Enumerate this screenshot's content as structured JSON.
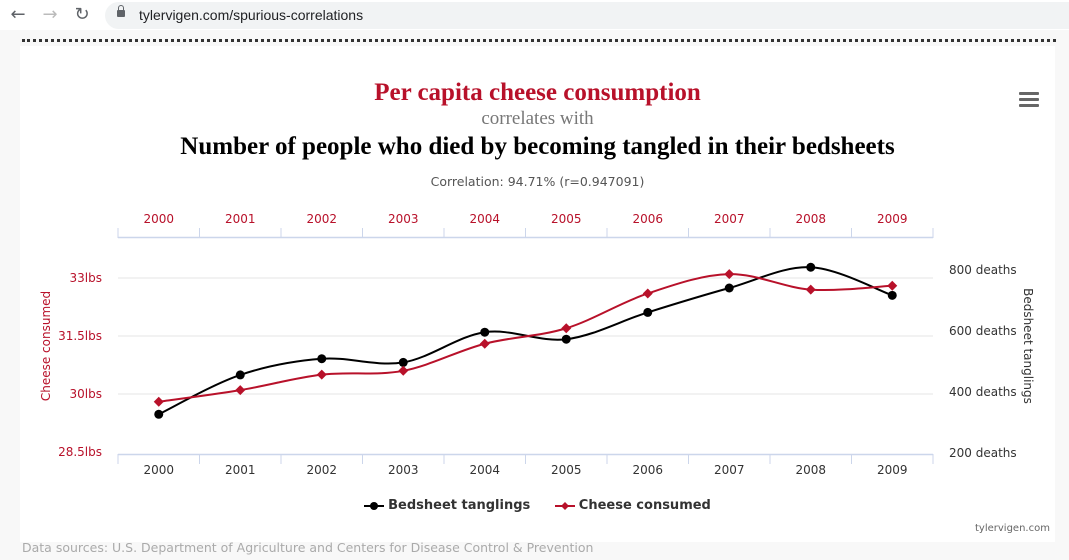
{
  "browser": {
    "url": "tylervigen.com/spurious-correlations",
    "back_icon": "←",
    "forward_icon": "→",
    "reload_icon": "↻"
  },
  "header": {
    "title_series1": "Per capita cheese consumption",
    "connector": "correlates with",
    "title_series2": "Number of people who died by becoming tangled in their bedsheets",
    "correlation": "Correlation: 94.71% (r=0.947091)"
  },
  "legend": {
    "items": [
      "Bedsheet tanglings",
      "Cheese consumed"
    ]
  },
  "footer": {
    "credit": "tylervigen.com",
    "sources": "Data sources: U.S. Department of Agriculture and Centers for Disease Control & Prevention"
  },
  "colors": {
    "cheese": "#b8112a",
    "bedsheet": "#000000",
    "grid": "#e6e6e6",
    "axis": "#ccd6eb"
  },
  "chart_data": {
    "type": "line",
    "title": "Per capita cheese consumption correlates with Number of people who died by becoming tangled in their bedsheets",
    "x": [
      "2000",
      "2001",
      "2002",
      "2003",
      "2004",
      "2005",
      "2006",
      "2007",
      "2008",
      "2009"
    ],
    "series": [
      {
        "name": "Bedsheet tanglings",
        "axis": "right",
        "color": "#000000",
        "marker": "circle",
        "values": [
          327,
          456,
          509,
          497,
          596,
          573,
          661,
          741,
          809,
          717
        ]
      },
      {
        "name": "Cheese consumed",
        "axis": "left",
        "color": "#b8112a",
        "marker": "diamond",
        "values": [
          29.8,
          30.1,
          30.5,
          30.6,
          31.3,
          31.7,
          32.6,
          33.1,
          32.7,
          32.8
        ]
      }
    ],
    "ylabel_left": "Cheese consumed",
    "ylabel_right": "Bedsheet tanglings",
    "yticks_left": [
      "33lbs",
      "31.5lbs",
      "30lbs",
      "28.5lbs"
    ],
    "yticks_left_values": [
      33,
      31.5,
      30,
      28.5
    ],
    "ylim_left": [
      28.5,
      33
    ],
    "yticks_right": [
      "800 deaths",
      "600 deaths",
      "400 deaths",
      "200 deaths"
    ],
    "yticks_right_values": [
      800,
      600,
      400,
      200
    ],
    "ylim_right": [
      200,
      800
    ],
    "grid": true,
    "legend": "bottom-center"
  }
}
